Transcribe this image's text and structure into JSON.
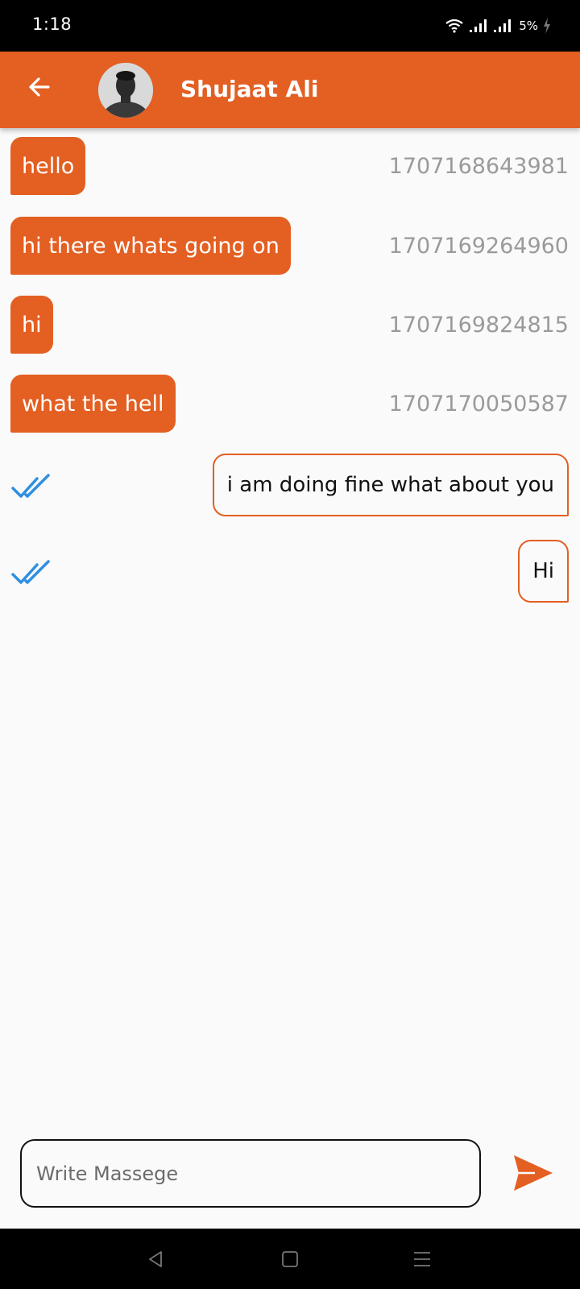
{
  "status_bar": {
    "time": "1:18",
    "battery": "5%"
  },
  "header": {
    "contact_name": "Shujaat Ali"
  },
  "messages": {
    "incoming": [
      {
        "text": "hello",
        "timestamp": "1707168643981"
      },
      {
        "text": "hi there whats going on",
        "timestamp": "1707169264960"
      },
      {
        "text": "hi",
        "timestamp": "1707169824815"
      },
      {
        "text": "what the hell",
        "timestamp": "1707170050587"
      }
    ],
    "outgoing": [
      {
        "text": "i am doing fine what about you",
        "status": "read"
      },
      {
        "text": "Hi",
        "status": "read"
      }
    ]
  },
  "composer": {
    "placeholder": "Write Massege"
  },
  "colors": {
    "accent": "#e35f22",
    "read_tick": "#2f8fe0",
    "timestamp": "#9a9a9a"
  },
  "icons": {
    "back": "arrow-left-icon",
    "send": "send-icon",
    "read": "double-check-icon",
    "nav": [
      "back-triangle-icon",
      "home-square-icon",
      "menu-lines-icon"
    ]
  }
}
